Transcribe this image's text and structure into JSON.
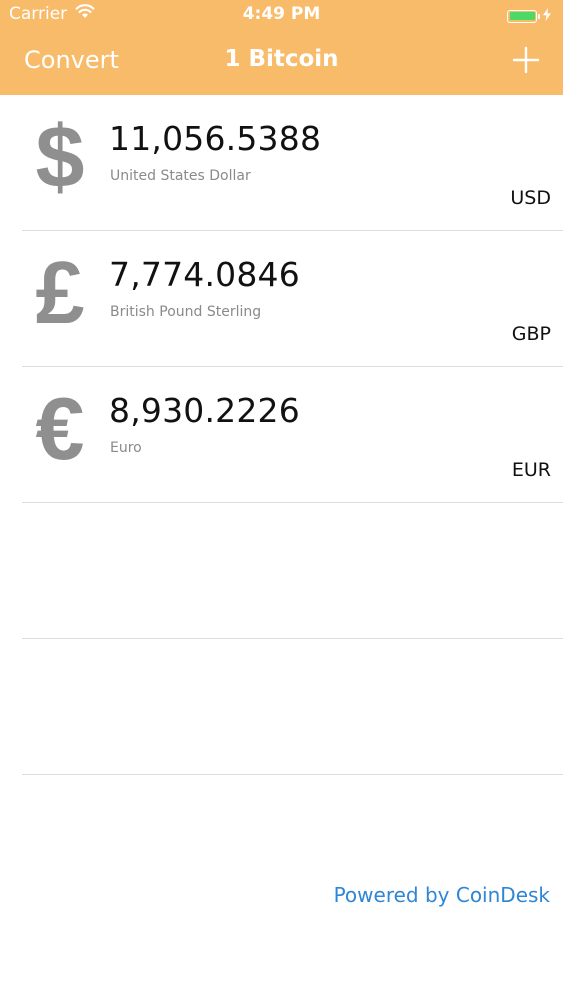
{
  "status_bar": {
    "carrier": "Carrier",
    "time": "4:49 PM",
    "battery_color": "#4cd964"
  },
  "nav": {
    "left_label": "Convert",
    "title": "1 Bitcoin",
    "add_icon": "plus-icon"
  },
  "colors": {
    "nav_background": "#f8bb6a",
    "link": "#2f86d6",
    "symbol": "#8f8f8f"
  },
  "currencies": [
    {
      "symbol": "$",
      "amount": "11,056.5388",
      "name": "United States Dollar",
      "code": "USD"
    },
    {
      "symbol": "£",
      "amount": "7,774.0846",
      "name": "British Pound Sterling",
      "code": "GBP"
    },
    {
      "symbol": "€",
      "amount": "8,930.2226",
      "name": "Euro",
      "code": "EUR"
    }
  ],
  "footer": {
    "powered_by": "Powered by CoinDesk"
  }
}
